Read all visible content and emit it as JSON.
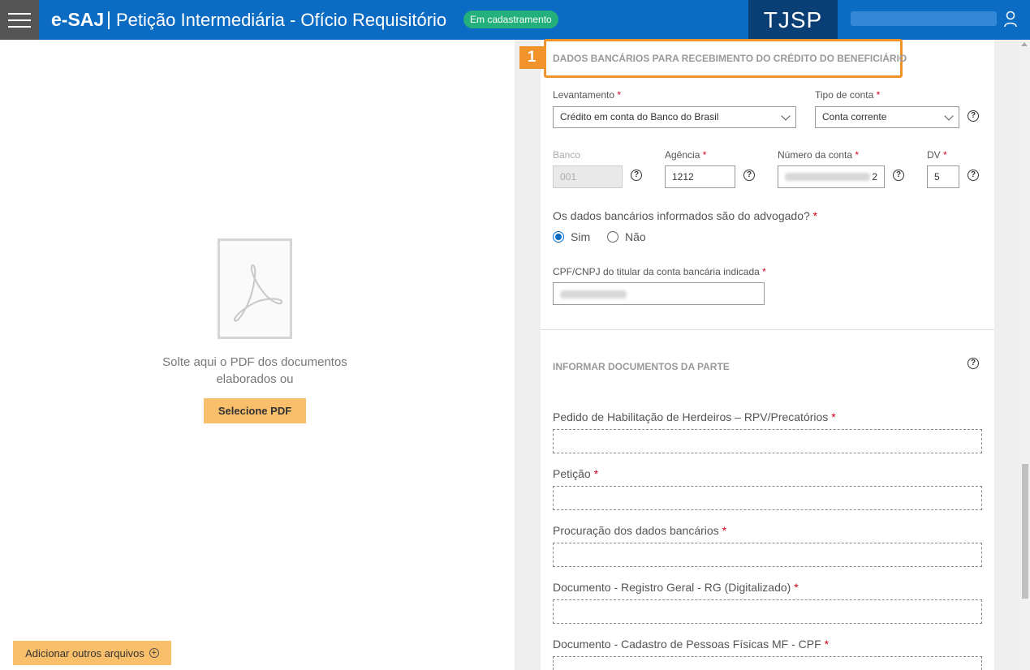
{
  "header": {
    "app_name": "e-SAJ",
    "separator": "|",
    "title": "Petição Intermediária - Ofício Requisitório",
    "status_badge": "Em cadastramento",
    "brand": "TJSP",
    "menu_icon": "hamburger-icon",
    "user_icon": "user-icon"
  },
  "left_pane": {
    "drop_text_line1": "Solte aqui o PDF dos documentos",
    "drop_text_line2": "elaborados ou",
    "select_button": "Selecione PDF",
    "add_files_button": "Adicionar outros arquivos",
    "pdf_icon": "pdf-file-icon"
  },
  "bank_section": {
    "step_number": "1",
    "title": "DADOS BANCÁRIOS PARA RECEBIMENTO DO CRÉDITO DO BENEFICIÁRIO",
    "levantamento_label": "Levantamento",
    "levantamento_value": "Crédito em conta do Banco do Brasil",
    "tipo_conta_label": "Tipo de conta",
    "tipo_conta_value": "Conta corrente",
    "banco_label": "Banco",
    "banco_value": "001",
    "agencia_label": "Agência",
    "agencia_value": "1212",
    "numero_conta_label": "Número da conta",
    "numero_conta_suffix": "2",
    "dv_label": "DV",
    "dv_value": "5",
    "question_label": "Os dados bancários informados são do advogado?",
    "option_yes": "Sim",
    "option_no": "Não",
    "cpf_label": "CPF/CNPJ do titular da conta bancária indicada",
    "required_mark": "*",
    "help_glyph": "?"
  },
  "documents_section": {
    "title": "INFORMAR DOCUMENTOS DA PARTE",
    "items": [
      {
        "label": "Pedido de Habilitação de Herdeiros – RPV/Precatórios"
      },
      {
        "label": "Petição"
      },
      {
        "label": "Procuração dos dados bancários"
      },
      {
        "label": "Documento - Registro Geral - RG (Digitalizado)"
      },
      {
        "label": "Documento - Cadastro de Pessoas Físicas MF - CPF"
      }
    ]
  },
  "colors": {
    "header_blue": "#0c6cc4",
    "brand_dark": "#0a3f75",
    "status_green": "#23b07d",
    "accent_orange": "#f0932b",
    "button_orange": "#f9bf6b",
    "required_red": "#d0021b"
  }
}
